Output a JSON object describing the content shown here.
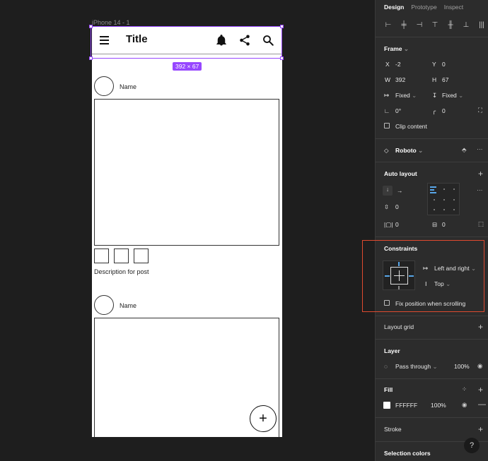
{
  "canvas": {
    "frame_label": "iPhone 14 - 1",
    "dimension_badge": "392 × 67",
    "app": {
      "title": "Title",
      "icons": [
        "menu-icon",
        "bell-icon",
        "share-icon",
        "search-icon"
      ],
      "posts": [
        {
          "name": "Name",
          "description": "Description for post"
        },
        {
          "name": "Name"
        }
      ],
      "fab_label": "+"
    }
  },
  "panel": {
    "tabs": [
      "Design",
      "Prototype",
      "Inspect"
    ],
    "active_tab": "Design",
    "frame": {
      "title": "Frame",
      "x_label": "X",
      "x": "-2",
      "y_label": "Y",
      "y": "0",
      "w_label": "W",
      "w": "392",
      "h_label": "H",
      "h": "67",
      "width_mode": "Fixed",
      "height_mode": "Fixed",
      "rotation": "0°",
      "radius": "0",
      "clip_content": "Clip content"
    },
    "text": {
      "font": "Roboto"
    },
    "auto_layout": {
      "title": "Auto layout",
      "spacing": "0",
      "padding_h": "0",
      "padding_v": "0"
    },
    "constraints": {
      "title": "Constraints",
      "horizontal": "Left and right",
      "vertical": "Top",
      "fix_position": "Fix position when scrolling"
    },
    "layout_grid": {
      "title": "Layout grid"
    },
    "layer": {
      "title": "Layer",
      "blend": "Pass through",
      "opacity": "100%"
    },
    "fill": {
      "title": "Fill",
      "hex": "FFFFFF",
      "opacity": "100%"
    },
    "stroke": {
      "title": "Stroke"
    },
    "selection_colors": {
      "title": "Selection colors"
    },
    "help": "?"
  },
  "colors": {
    "selection": "#9747ff",
    "highlight": "#e04a2f",
    "panel_bg": "#2c2c2c",
    "canvas_bg": "#1e1e1e"
  }
}
